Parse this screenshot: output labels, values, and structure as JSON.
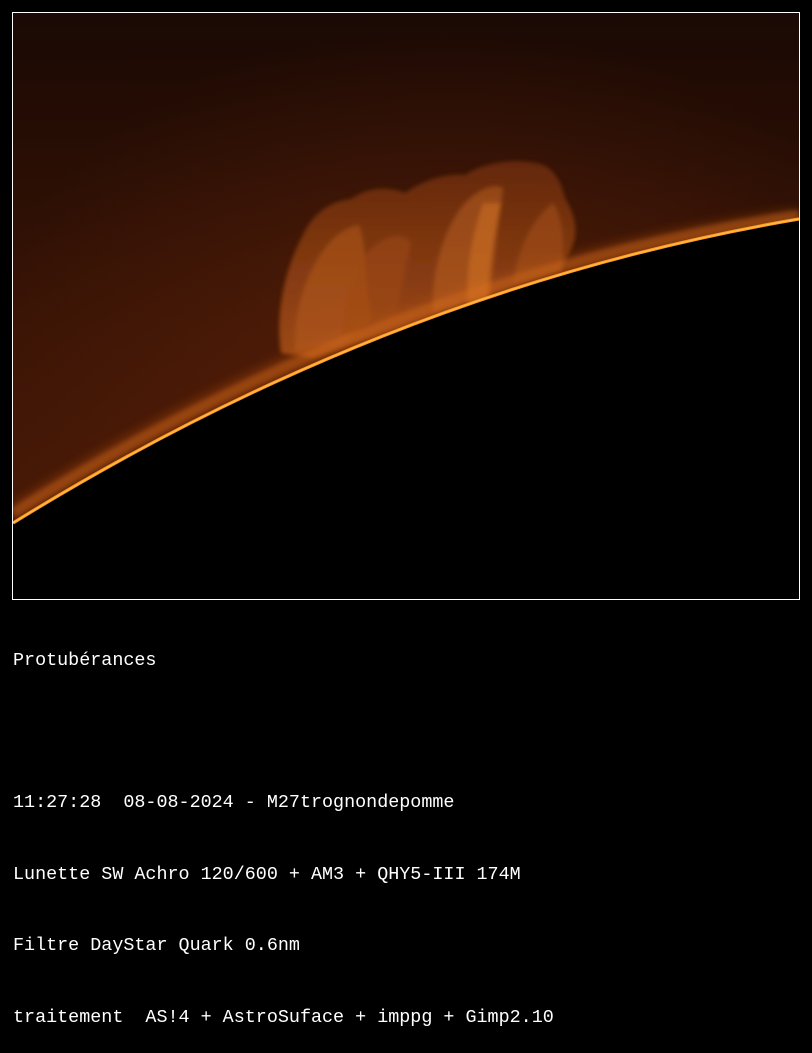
{
  "photo": {
    "subject": "solar-limb-prominence",
    "colors": {
      "sky_top": "#1a0904",
      "sky_bottom": "#4a1a06",
      "limb": "#ff9a1e",
      "prominence": "#b5521a",
      "disk": "#000000",
      "border": "#ffffff"
    }
  },
  "caption": {
    "title": "Protubérances",
    "blank": "",
    "datetime": "11:27:28  08-08-2024 - M27trognondepomme",
    "equipment": "Lunette SW Achro 120/600 + AM3 + QHY5-III 174M",
    "filter": "Filtre DayStar Quark 0.6nm",
    "processing": "traitement  AS!4 + AstroSuface + imppg + Gimp2.10"
  }
}
